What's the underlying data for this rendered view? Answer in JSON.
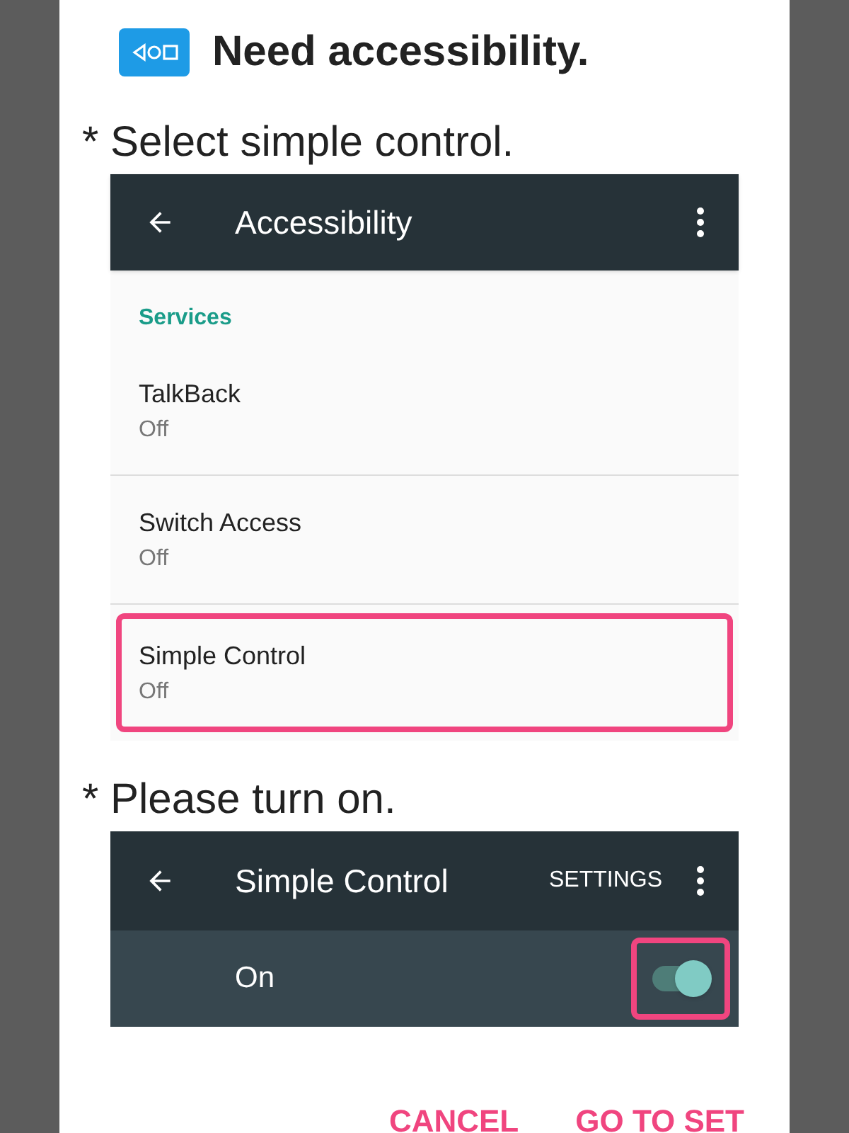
{
  "dialog": {
    "title": "Need accessibility."
  },
  "step_1": {
    "instruction": "* Select simple control.",
    "toolbar_title": "Accessibility",
    "section": "Services",
    "services": [
      {
        "name": "TalkBack",
        "status": "Off",
        "highlighted": false
      },
      {
        "name": "Switch Access",
        "status": "Off",
        "highlighted": false
      },
      {
        "name": "Simple Control",
        "status": "Off",
        "highlighted": true
      }
    ]
  },
  "step_2": {
    "instruction": "* Please turn on.",
    "toolbar_title": "Simple Control",
    "action": "SETTINGS",
    "switch_label": "On",
    "on": true,
    "highlighted": true
  },
  "buttons": [
    "CANCEL",
    "GO TO SET"
  ]
}
